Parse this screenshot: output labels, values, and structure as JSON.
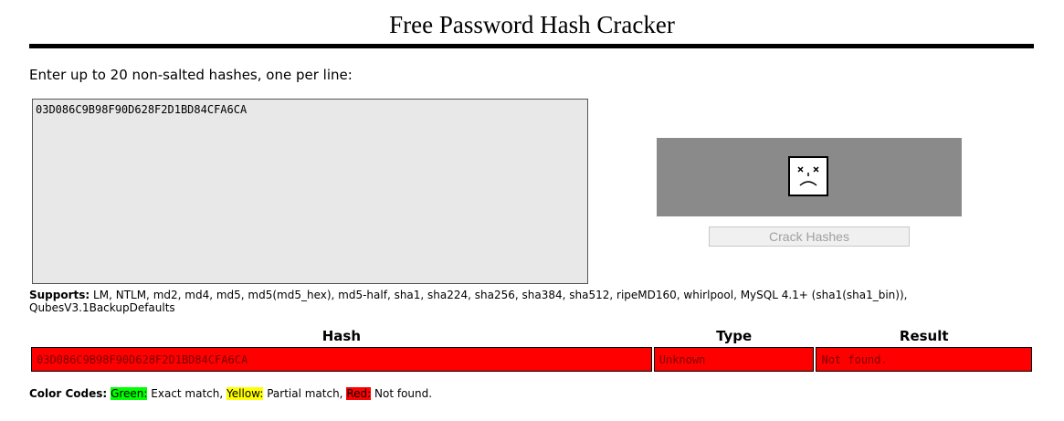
{
  "page": {
    "title": "Free Password Hash Cracker"
  },
  "form": {
    "instruction": "Enter up to 20 non-salted hashes, one per line:",
    "textarea_value": "03D086C9B98F90D628F2D1BD84CFA6CA",
    "captcha_icon": "sad-face-broken-image-icon",
    "crack_button_label": "Crack Hashes"
  },
  "supports": {
    "label": "Supports:",
    "text": "LM, NTLM, md2, md4, md5, md5(md5_hex), md5-half, sha1, sha224, sha256, sha384, sha512, ripeMD160, whirlpool, MySQL 4.1+ (sha1(sha1_bin)), QubesV3.1BackupDefaults"
  },
  "results": {
    "headers": [
      "Hash",
      "Type",
      "Result"
    ],
    "rows": [
      {
        "hash": "03D086C9B98F90D628F2D1BD84CFA6CA",
        "type": "Unknown",
        "result": "Not found.",
        "color": "#ff0000"
      }
    ]
  },
  "legend": {
    "label": "Color Codes:",
    "green_label": "Green:",
    "green_text": "Exact match,",
    "yellow_label": "Yellow:",
    "yellow_text": "Partial match,",
    "red_label": "Red:",
    "red_text": "Not found.",
    "colors": {
      "green": "#00ff00",
      "yellow": "#ffff00",
      "red": "#ff0000"
    }
  }
}
